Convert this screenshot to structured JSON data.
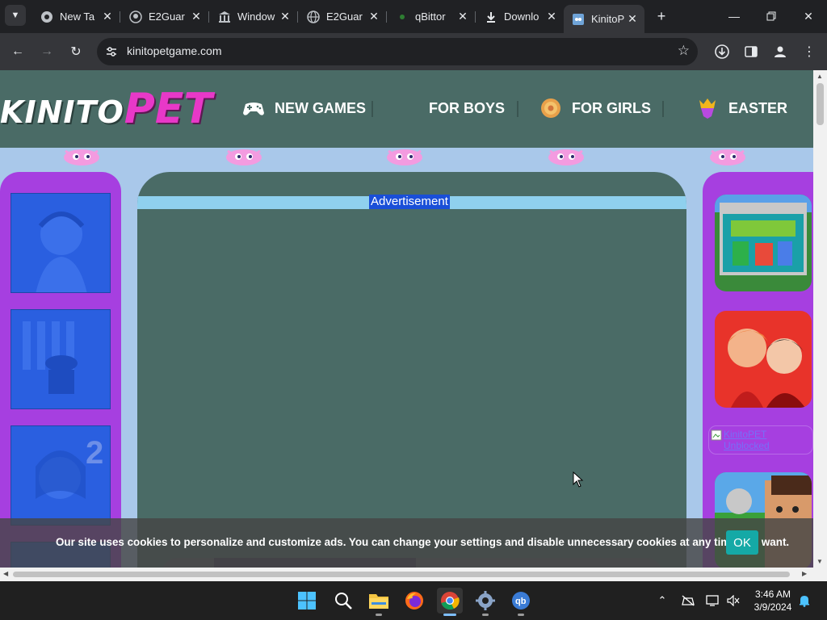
{
  "browser": {
    "tabs": [
      {
        "title": "New Ta",
        "icon": "chrome-icon"
      },
      {
        "title": "E2Guar",
        "icon": "github-icon"
      },
      {
        "title": "Window",
        "icon": "bank-icon"
      },
      {
        "title": "E2Guar",
        "icon": "globe-icon"
      },
      {
        "title": "qBittor",
        "icon": "qbittorrent-icon"
      },
      {
        "title": "Downlo",
        "icon": "download-icon"
      },
      {
        "title": "KinitoP",
        "icon": "kinito-icon",
        "active": true
      }
    ],
    "address": "kinitopetgame.com"
  },
  "site": {
    "logo": {
      "part1": "KINITO",
      "part2": "PET"
    },
    "nav": [
      {
        "label": "NEW GAMES",
        "icon": "gamepad-icon"
      },
      {
        "label": "FOR BOYS",
        "icon": ""
      },
      {
        "label": "FOR GIRLS",
        "icon": "flower-badge-icon"
      },
      {
        "label": "EASTER",
        "icon": "crown-shield-icon"
      }
    ],
    "ad_label": "Advertisement",
    "broken_image_alt": "KinitoPET Unblocked"
  },
  "cookie": {
    "text": "Our site uses cookies to personalize and customize ads. You can change your settings and disable unnecessary cookies at any time you want.",
    "ok_label": "OK"
  },
  "taskbar": {
    "apps": [
      "windows-start-icon",
      "search-icon",
      "file-explorer-icon",
      "firefox-icon",
      "chrome-icon",
      "settings-icon",
      "qbittorrent-icon"
    ],
    "time": "3:46 AM",
    "date": "3/9/2024"
  },
  "colors": {
    "header_bg": "#4a6b66",
    "page_bg": "#a9c8ea",
    "side_column": "#a63fe0",
    "logo_pet": "#e838c8",
    "ok_button": "#15a9a6"
  }
}
